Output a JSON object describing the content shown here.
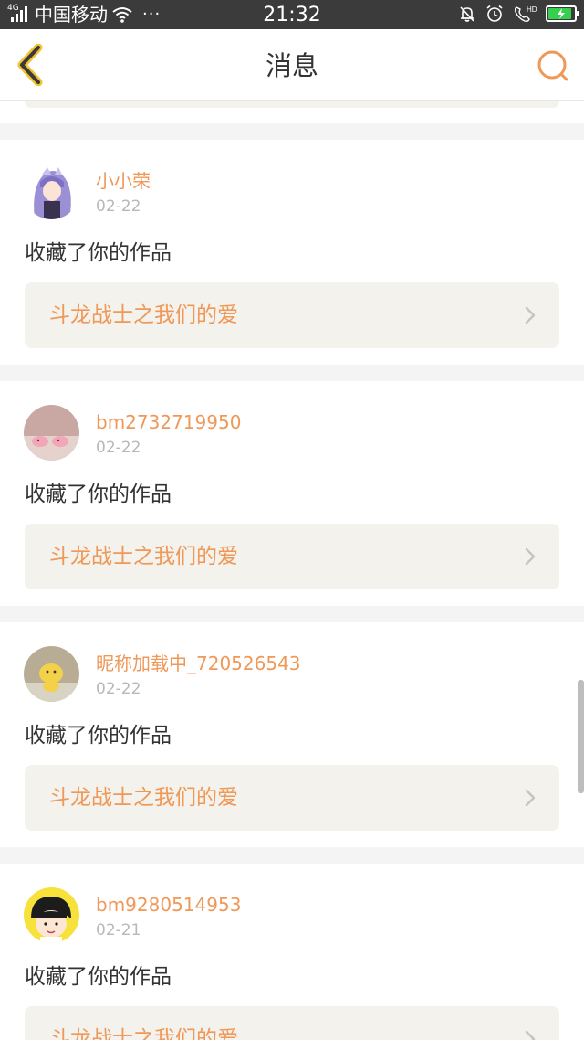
{
  "status_bar": {
    "network": "4G",
    "carrier": "中国移动",
    "more": "···",
    "time": "21:32",
    "battery_level": 0.9,
    "battery_color": "#35d14e"
  },
  "nav": {
    "title": "消息",
    "back_icon": "chevron-left-icon",
    "search_icon": "search-icon",
    "accent": "#ef9858"
  },
  "messages": [
    {
      "user": "小小荣",
      "date": "02-22",
      "action": "收藏了你的作品",
      "work": "斗龙战士之我们的爱"
    },
    {
      "user": "bm2732719950",
      "date": "02-22",
      "action": "收藏了你的作品",
      "work": "斗龙战士之我们的爱"
    },
    {
      "user": "昵称加载中_720526543",
      "date": "02-22",
      "action": "收藏了你的作品",
      "work": "斗龙战士之我们的爱"
    },
    {
      "user": "bm9280514953",
      "date": "02-21",
      "action": "收藏了你的作品",
      "work": "斗龙战士之我们的爱"
    }
  ]
}
